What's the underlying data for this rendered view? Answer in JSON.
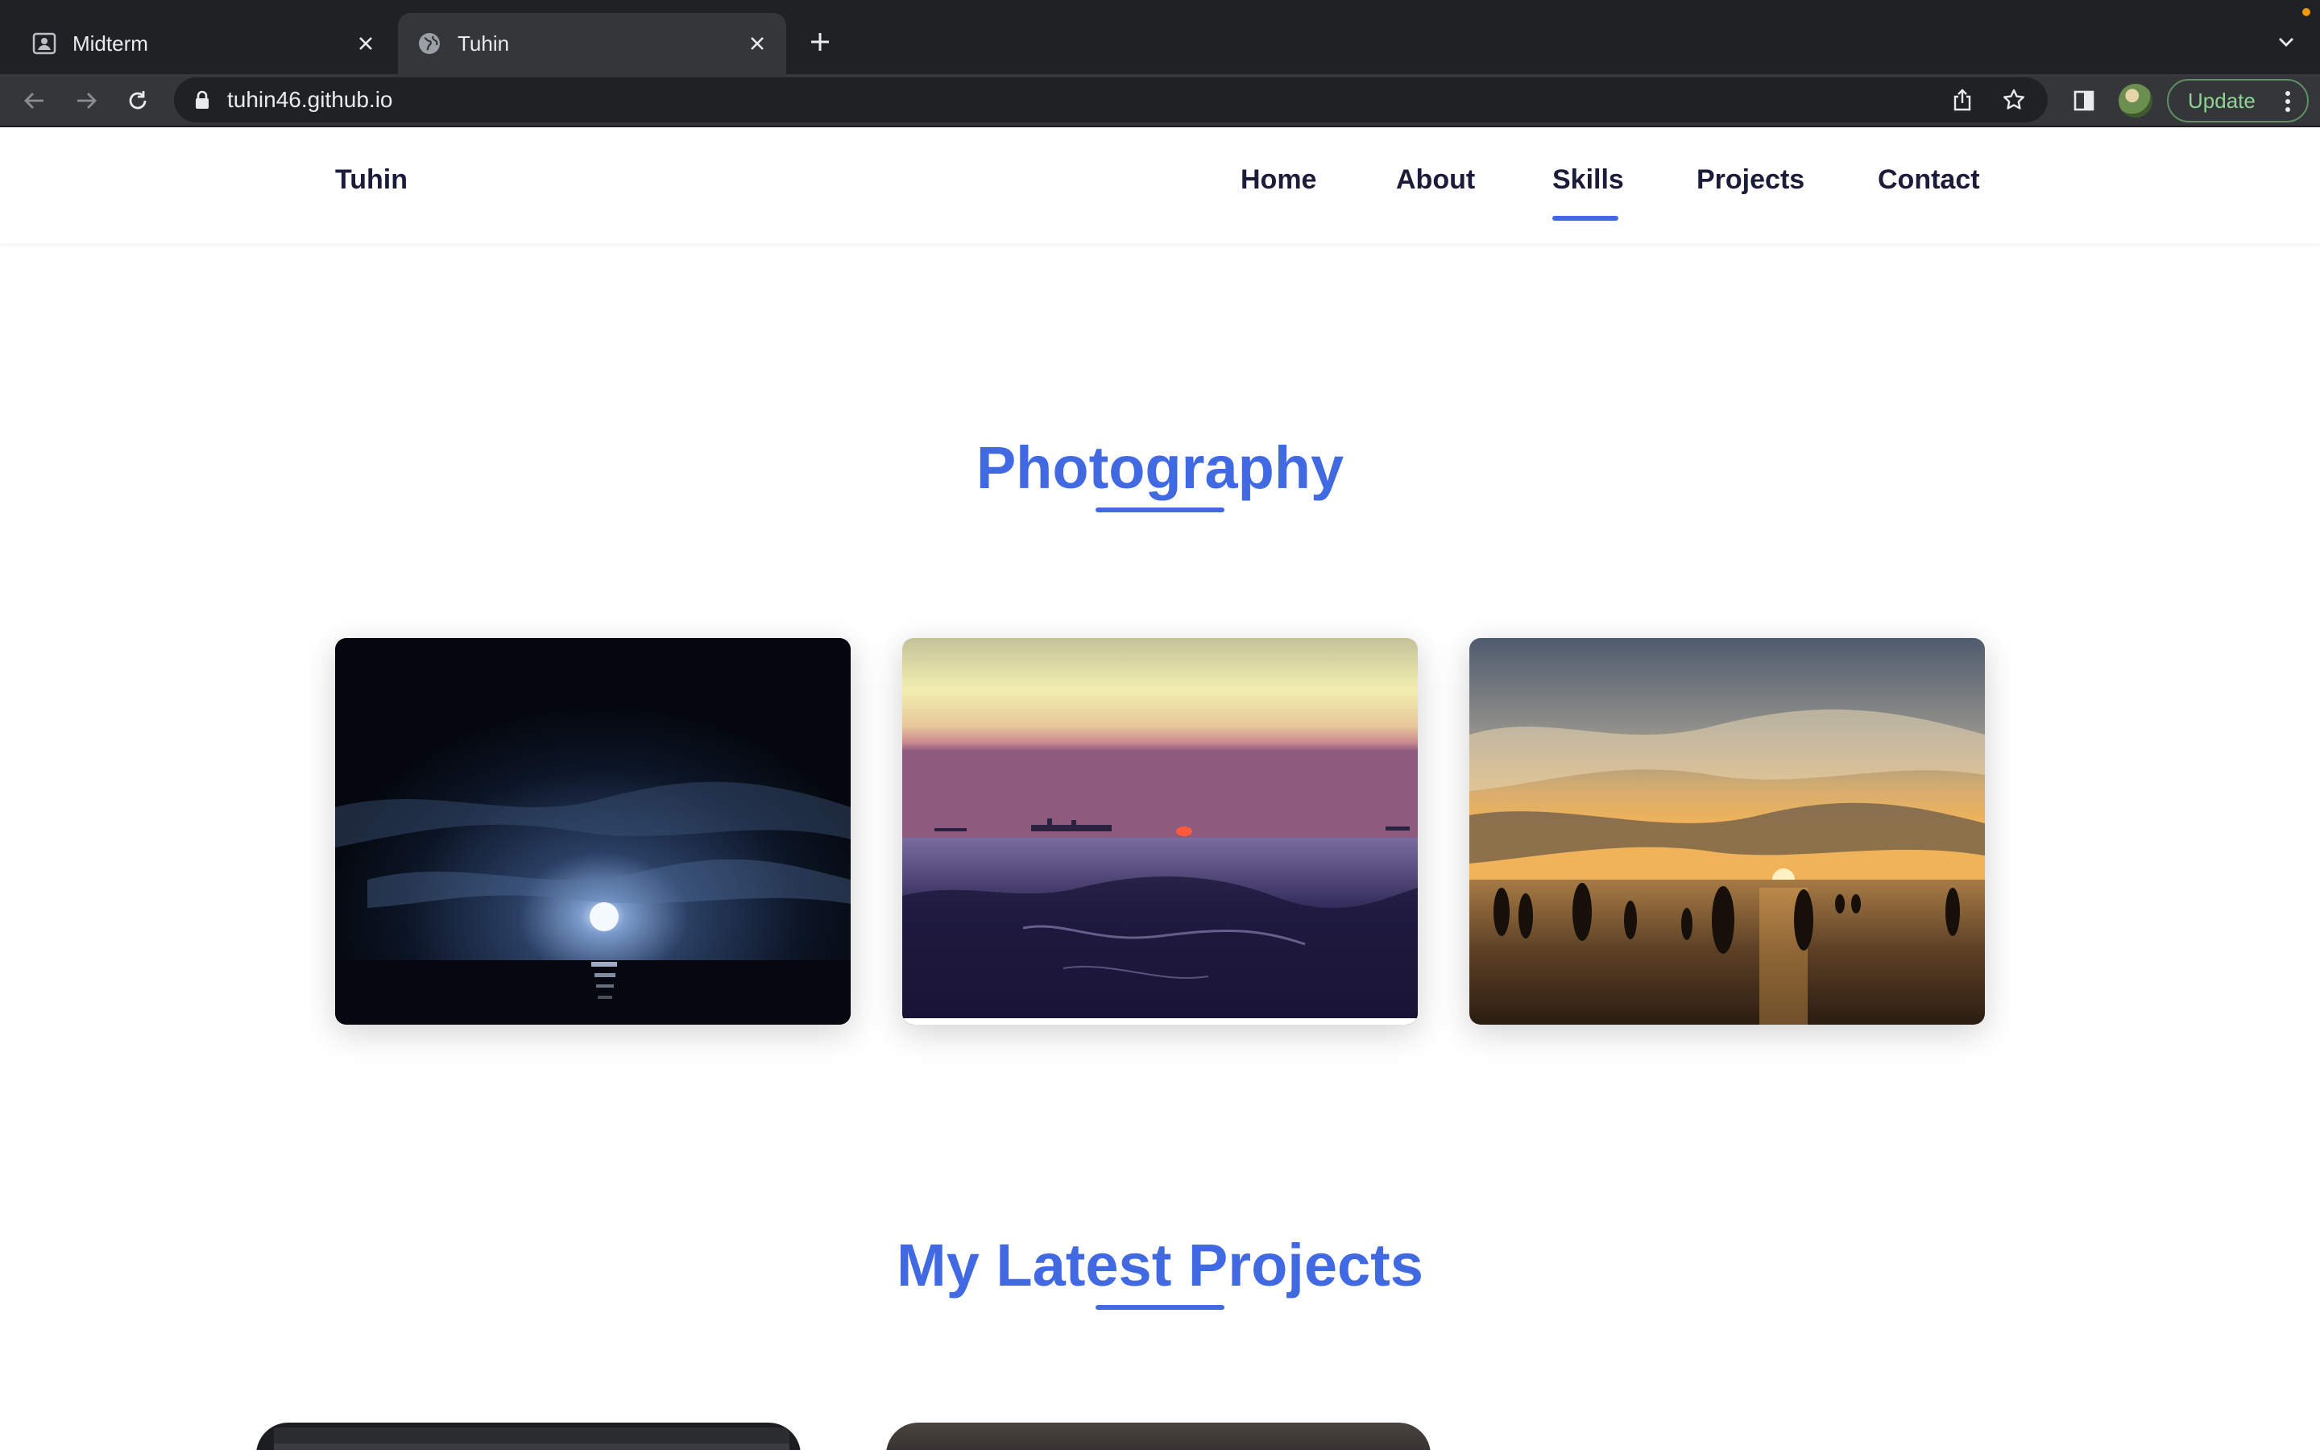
{
  "browser": {
    "tabs": [
      {
        "title": "Midterm",
        "favicon": "contact-card-icon",
        "active": false
      },
      {
        "title": "Tuhin",
        "favicon": "globe-icon",
        "active": true
      }
    ],
    "url": "tuhin46.github.io",
    "update_label": "Update",
    "colors": {
      "tabbar": "#202124",
      "toolbar": "#35363a",
      "update_accent": "#8fd394"
    }
  },
  "site": {
    "brand": "Tuhin",
    "nav": [
      {
        "label": "Home"
      },
      {
        "label": "About"
      },
      {
        "label": "Skills",
        "active": true
      },
      {
        "label": "Projects"
      },
      {
        "label": "Contact"
      }
    ],
    "accent_color": "#4169e1",
    "text_color": "#1b1b3a"
  },
  "photography": {
    "title": "Photography",
    "photos": [
      {
        "name": "moonlit-sea-photo"
      },
      {
        "name": "sunset-ships-photo"
      },
      {
        "name": "beach-sunset-people-photo"
      }
    ]
  },
  "projects": {
    "title": "My Latest Projects"
  }
}
